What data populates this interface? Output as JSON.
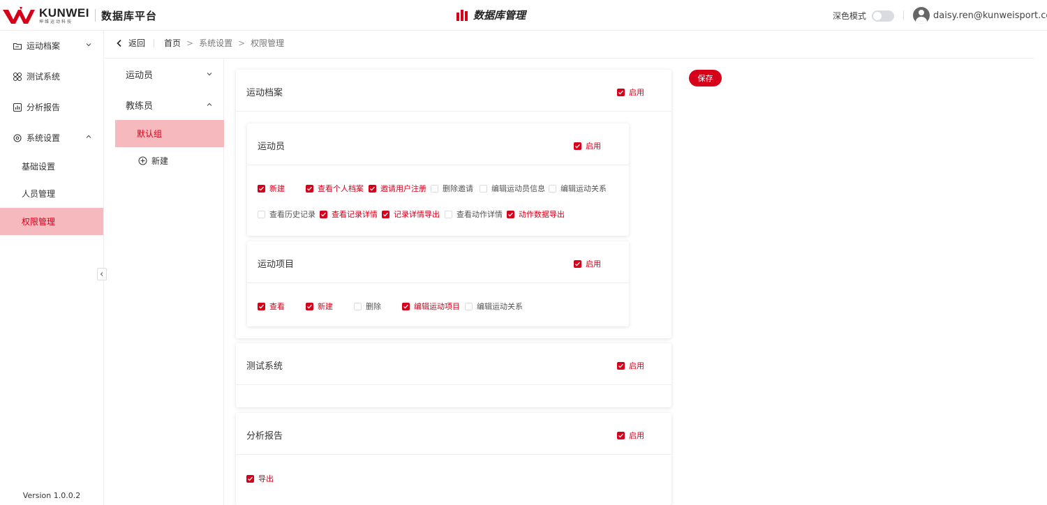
{
  "header": {
    "logo_word": "KUNWEI",
    "logo_sub": "坤维运动科技",
    "platform": "数据库平台",
    "center_title": "数据库管理",
    "dark_mode_label": "深色模式",
    "user_email": "daisy.ren@kunweisport.com"
  },
  "sidebar": {
    "items": [
      {
        "label": "运动档案"
      },
      {
        "label": "测试系统"
      },
      {
        "label": "分析报告"
      },
      {
        "label": "系统设置"
      }
    ],
    "sub_items": [
      {
        "label": "基础设置"
      },
      {
        "label": "人员管理"
      },
      {
        "label": "权限管理"
      }
    ],
    "version": "Version 1.0.0.2"
  },
  "breadcrumb": {
    "back": "返回",
    "home": "首页",
    "level1": "系统设置",
    "level2": "权限管理"
  },
  "roles": {
    "athlete": "运动员",
    "coach": "教练员",
    "default_group": "默认组",
    "new": "新建"
  },
  "save_label": "保存",
  "enable_label": "启用",
  "cards": {
    "archive": {
      "title": "运动档案",
      "athlete": {
        "title": "运动员",
        "perms": [
          {
            "label": "新建",
            "checked": true
          },
          {
            "label": "查看个人档案",
            "checked": true
          },
          {
            "label": "邀请用户注册",
            "checked": true
          },
          {
            "label": "删除邀请",
            "checked": false
          },
          {
            "label": "编辑运动员信息",
            "checked": false
          },
          {
            "label": "编辑运动关系",
            "checked": false
          },
          {
            "label": "查看历史记录",
            "checked": false
          },
          {
            "label": "查看记录详情",
            "checked": true
          },
          {
            "label": "记录详情导出",
            "checked": true
          },
          {
            "label": "查看动作详情",
            "checked": false
          },
          {
            "label": "动作数据导出",
            "checked": true
          }
        ]
      },
      "project": {
        "title": "运动项目",
        "perms": [
          {
            "label": "查看",
            "checked": true
          },
          {
            "label": "新建",
            "checked": true
          },
          {
            "label": "删除",
            "checked": false
          },
          {
            "label": "编辑运动项目",
            "checked": true
          },
          {
            "label": "编辑运动关系",
            "checked": false
          }
        ]
      }
    },
    "test": {
      "title": "测试系统"
    },
    "report": {
      "title": "分析报告",
      "perms": [
        {
          "label": "导出",
          "checked": true
        }
      ]
    }
  },
  "colors": {
    "accent": "#d7001b",
    "active_bg": "#f6b9bd"
  }
}
